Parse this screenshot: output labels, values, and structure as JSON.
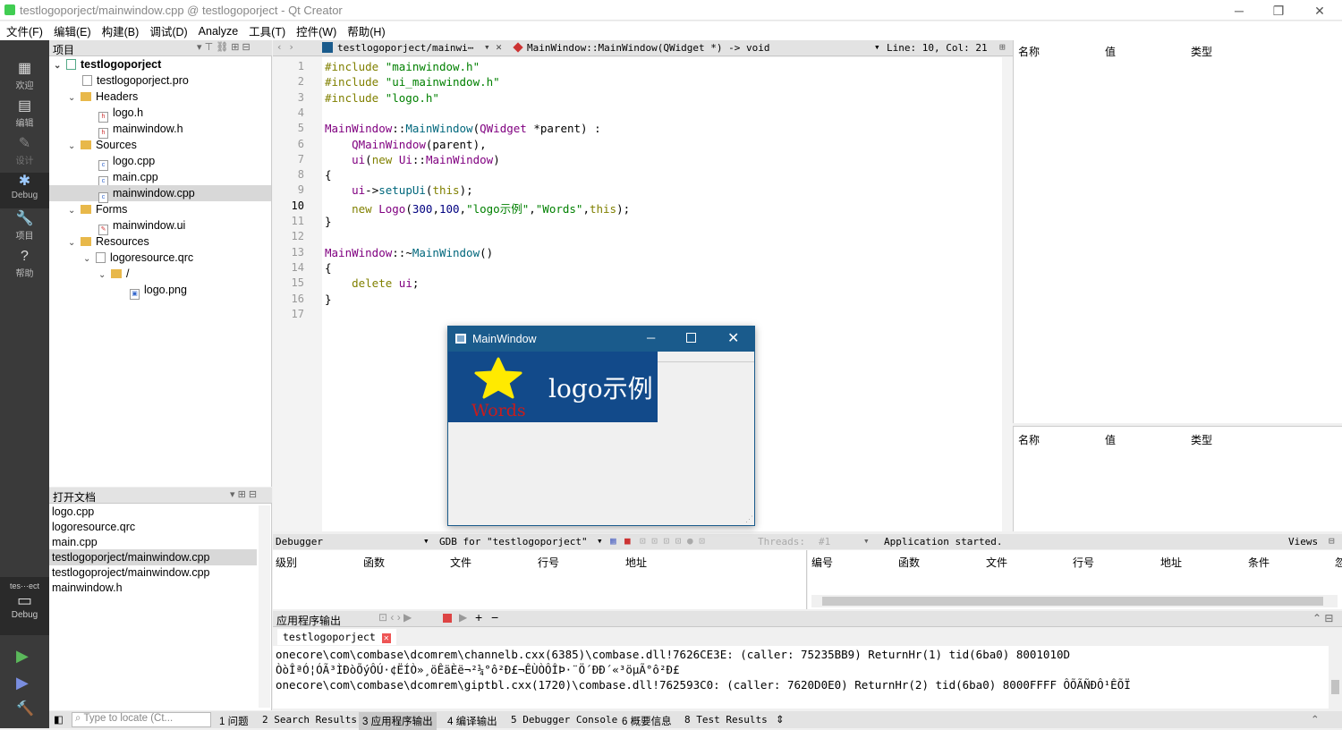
{
  "window": {
    "title": "testlogoporject/mainwindow.cpp @ testlogoporject - Qt Creator",
    "min": "─",
    "max": "❐",
    "close": "✕"
  },
  "menu": [
    "文件(F)",
    "编辑(E)",
    "构建(B)",
    "调试(D)",
    "Analyze",
    "工具(T)",
    "控件(W)",
    "帮助(H)"
  ],
  "modes": [
    {
      "label": "欢迎",
      "icon": "▦"
    },
    {
      "label": "编辑",
      "icon": "▤"
    },
    {
      "label": "设计",
      "icon": "✎"
    },
    {
      "label": "Debug",
      "icon": "✱"
    },
    {
      "label": "项目",
      "icon": "🔧"
    },
    {
      "label": "帮助",
      "icon": "?"
    }
  ],
  "modes_bottom": {
    "kit": "tes⋯ect",
    "kit_label": "Debug",
    "kit_icon": "▭",
    "run_icon": "▶",
    "debug_icon": "▶",
    "build_icon": "🔨"
  },
  "project": {
    "header": "项目",
    "tree": [
      {
        "label": "testlogoporject",
        "bold": true
      },
      {
        "label": "testlogoporject.pro"
      },
      {
        "label": "Headers"
      },
      {
        "label": "logo.h"
      },
      {
        "label": "mainwindow.h"
      },
      {
        "label": "Sources"
      },
      {
        "label": "logo.cpp"
      },
      {
        "label": "main.cpp"
      },
      {
        "label": "mainwindow.cpp"
      },
      {
        "label": "Forms"
      },
      {
        "label": "mainwindow.ui"
      },
      {
        "label": "Resources"
      },
      {
        "label": "logoresource.qrc"
      },
      {
        "label": "/"
      },
      {
        "label": "logo.png"
      }
    ]
  },
  "open_docs": {
    "header": "打开文档",
    "items": [
      "logo.cpp",
      "logoresource.qrc",
      "main.cpp",
      "testlogoporject/mainwindow.cpp",
      "testlogoproject/mainwindow.cpp",
      "mainwindow.h"
    ]
  },
  "editor": {
    "file": "testlogoporject/mainwi⋯",
    "symbol": "MainWindow::MainWindow(QWidget *) -> void",
    "pos": "Line: 10, Col: 21",
    "line_numbers": [
      "1",
      "2",
      "3",
      "4",
      "5",
      "6",
      "7",
      "8",
      "9",
      "10",
      "11",
      "12",
      "13",
      "14",
      "15",
      "16",
      "17"
    ],
    "lines": [
      [
        [
          "kw",
          "#include "
        ],
        [
          "str",
          "\"mainwindow.h\""
        ]
      ],
      [
        [
          "kw",
          "#include "
        ],
        [
          "str",
          "\"ui_mainwindow.h\""
        ]
      ],
      [
        [
          "kw",
          "#include "
        ],
        [
          "str",
          "\"logo.h\""
        ]
      ],
      [],
      [
        [
          "ty",
          "MainWindow"
        ],
        [
          "",
          "::"
        ],
        [
          "fn",
          "MainWindow"
        ],
        [
          "",
          "("
        ],
        [
          "ty",
          "QWidget"
        ],
        [
          "",
          " *parent) :"
        ]
      ],
      [
        [
          "",
          "    "
        ],
        [
          "ty",
          "QMainWindow"
        ],
        [
          "",
          "(parent),"
        ]
      ],
      [
        [
          "",
          "    "
        ],
        [
          "ty",
          "ui"
        ],
        [
          "",
          "("
        ],
        [
          "kw",
          "new "
        ],
        [
          "ty",
          "Ui"
        ],
        [
          "",
          "::"
        ],
        [
          "ty",
          "MainWindow"
        ],
        [
          "",
          ")"
        ]
      ],
      [
        [
          "",
          "{"
        ]
      ],
      [
        [
          "",
          "    "
        ],
        [
          "ty",
          "ui"
        ],
        [
          "",
          "->"
        ],
        [
          "fn",
          "setupUi"
        ],
        [
          "",
          "("
        ],
        [
          "kw",
          "this"
        ],
        [
          "",
          ");"
        ]
      ],
      [
        [
          "",
          "    "
        ],
        [
          "kw",
          "new "
        ],
        [
          "ty",
          "Logo"
        ],
        [
          "",
          "("
        ],
        [
          "num",
          "300"
        ],
        [
          "",
          ","
        ],
        [
          "num",
          "100"
        ],
        [
          "",
          ","
        ],
        [
          "str",
          "\"logo示例\""
        ],
        [
          "",
          ","
        ],
        [
          "str",
          "\"Words\""
        ],
        [
          "",
          ","
        ],
        [
          "kw",
          "this"
        ],
        [
          "",
          ");"
        ]
      ],
      [
        [
          "",
          "}"
        ]
      ],
      [],
      [
        [
          "ty",
          "MainWindow"
        ],
        [
          "",
          "::~"
        ],
        [
          "fn",
          "MainWindow"
        ],
        [
          "",
          "()"
        ]
      ],
      [
        [
          "",
          "{"
        ]
      ],
      [
        [
          "",
          "    "
        ],
        [
          "kw",
          "delete "
        ],
        [
          "ty",
          "ui"
        ],
        [
          "",
          ";"
        ]
      ],
      [
        [
          "",
          "}"
        ]
      ],
      []
    ]
  },
  "watch_top": {
    "cols": [
      "名称",
      "值",
      "类型"
    ]
  },
  "watch_bottom": {
    "cols": [
      "名称",
      "值",
      "类型"
    ]
  },
  "debugger": {
    "label": "Debugger",
    "engine": "GDB for \"testlogoporject\"",
    "threads": "Threads:",
    "thread_no": "#1",
    "status": "Application started.",
    "views": "Views",
    "stack_cols": [
      "级别",
      "函数",
      "文件",
      "行号",
      "地址"
    ],
    "break_cols": [
      "编号",
      "函数",
      "文件",
      "行号",
      "地址",
      "条件",
      "忽"
    ]
  },
  "appout": {
    "header": "应用程序输出",
    "tab": "testlogoporject",
    "lines": [
      "onecore\\com\\combase\\dcomrem\\channelb.cxx(6385)\\combase.dll!7626CE3E: (caller: 75235BB9) ReturnHr(1) tid(6ba0) 8001010D",
      "ÒòÎªÓ¦ÓÃ³ÌÐòÕýÔÚ·¢ËÍÒ»¸öÊäÈë¬²¼°ô²Ð£¬ÊÙÒÔÎÞ·¨Ö´ÐÐ´«³öµÃ°ô²Ð£",
      "onecore\\com\\combase\\dcomrem\\giptbl.cxx(1720)\\combase.dll!762593C0: (caller: 7620D0E0) ReturnHr(2) tid(6ba0) 8000FFFF ÔÕÃÑÐÔ¹ÊÕÏ"
    ]
  },
  "status": {
    "locate": "Type to locate (Ct...",
    "tabs": [
      "1 问题",
      "2 Search Results",
      "3 应用程序输出",
      "4 编译输出",
      "5 Debugger Console",
      "6 概要信息",
      "8 Test Results"
    ]
  },
  "mainwindow": {
    "title": "MainWindow",
    "logo_text": "logo示例",
    "words": "Words",
    "star_icon": "star-icon"
  }
}
